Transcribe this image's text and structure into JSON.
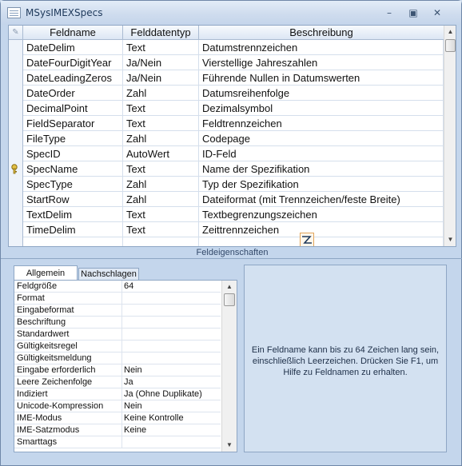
{
  "window": {
    "title": "MSysIMEXSpecs",
    "minimize_icon": "minimize-icon",
    "maximize_icon": "maximize-icon",
    "close_icon": "close-icon"
  },
  "grid": {
    "columns": [
      "Feldname",
      "Felddatentyp",
      "Beschreibung"
    ],
    "rows": [
      {
        "name": "DateDelim",
        "type": "Text",
        "desc": "Datumstrennzeichen"
      },
      {
        "name": "DateFourDigitYear",
        "type": "Ja/Nein",
        "desc": "Vierstellige Jahreszahlen"
      },
      {
        "name": "DateLeadingZeros",
        "type": "Ja/Nein",
        "desc": "Führende Nullen in Datumswerten"
      },
      {
        "name": "DateOrder",
        "type": "Zahl",
        "desc": "Datumsreihenfolge"
      },
      {
        "name": "DecimalPoint",
        "type": "Text",
        "desc": "Dezimalsymbol"
      },
      {
        "name": "FieldSeparator",
        "type": "Text",
        "desc": "Feldtrennzeichen"
      },
      {
        "name": "FileType",
        "type": "Zahl",
        "desc": "Codepage"
      },
      {
        "name": "SpecID",
        "type": "AutoWert",
        "desc": "ID-Feld"
      },
      {
        "name": "SpecName",
        "type": "Text",
        "desc": "Name der Spezifikation",
        "key": true
      },
      {
        "name": "SpecType",
        "type": "Zahl",
        "desc": "Typ der Spezifikation"
      },
      {
        "name": "StartRow",
        "type": "Zahl",
        "desc": "Dateiformat (mit Trennzeichen/feste Breite)"
      },
      {
        "name": "TextDelim",
        "type": "Text",
        "desc": "Textbegrenzungszeichen"
      },
      {
        "name": "TimeDelim",
        "type": "Text",
        "desc": "Zeittrennzeichen"
      },
      {
        "name": "",
        "type": "",
        "desc": ""
      }
    ],
    "primary_key_icon": "primary-key-icon"
  },
  "field_properties": {
    "label": "Feldeigenschaften",
    "tabs": [
      "Allgemein",
      "Nachschlagen"
    ],
    "active_tab": "Allgemein",
    "rows": [
      {
        "name": "Feldgröße",
        "value": "64"
      },
      {
        "name": "Format",
        "value": ""
      },
      {
        "name": "Eingabeformat",
        "value": ""
      },
      {
        "name": "Beschriftung",
        "value": ""
      },
      {
        "name": "Standardwert",
        "value": ""
      },
      {
        "name": "Gültigkeitsregel",
        "value": ""
      },
      {
        "name": "Gültigkeitsmeldung",
        "value": ""
      },
      {
        "name": "Eingabe erforderlich",
        "value": "Nein"
      },
      {
        "name": "Leere Zeichenfolge",
        "value": "Ja"
      },
      {
        "name": "Indiziert",
        "value": "Ja (Ohne Duplikate)"
      },
      {
        "name": "Unicode-Kompression",
        "value": "Nein"
      },
      {
        "name": "IME-Modus",
        "value": "Keine Kontrolle"
      },
      {
        "name": "IME-Satzmodus",
        "value": "Keine"
      },
      {
        "name": "Smarttags",
        "value": ""
      }
    ],
    "help_text": "Ein Feldname kann bis zu 64 Zeichen lang sein, einschließlich Leerzeichen. Drücken Sie F1, um Hilfe zu Feldnamen zu erhalten."
  }
}
